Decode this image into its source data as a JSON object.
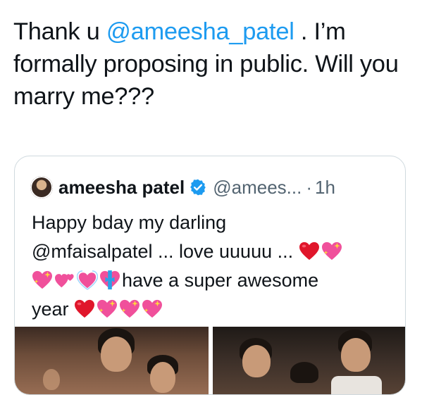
{
  "tweet": {
    "text_before": "Thank u ",
    "mention": "@ameesha_patel",
    "text_after": " . I’m formally proposing in public. Will you marry me???"
  },
  "quote": {
    "display_name": "ameesha patel",
    "handle": "@amees...",
    "separator": "·",
    "time": "1h",
    "line1": "Happy bday my darling",
    "line2": "@mfaisalpatel ... love uuuuu ...",
    "line3_text": "have a super awesome",
    "line4_text": "year",
    "media": [
      "photo",
      "photo"
    ]
  },
  "icons": {
    "verified": "verified-badge-icon",
    "red_heart": "red-heart-icon",
    "sparkling_heart": "sparkling-heart-icon",
    "revolving_hearts": "revolving-hearts-icon",
    "growing_heart": "growing-heart-icon",
    "heart_ribbon": "heart-with-ribbon-icon"
  },
  "colors": {
    "mention": "#1d9bf0",
    "secondary_text": "#536471",
    "border": "#cfd9de",
    "verified": "#1d9bf0"
  }
}
